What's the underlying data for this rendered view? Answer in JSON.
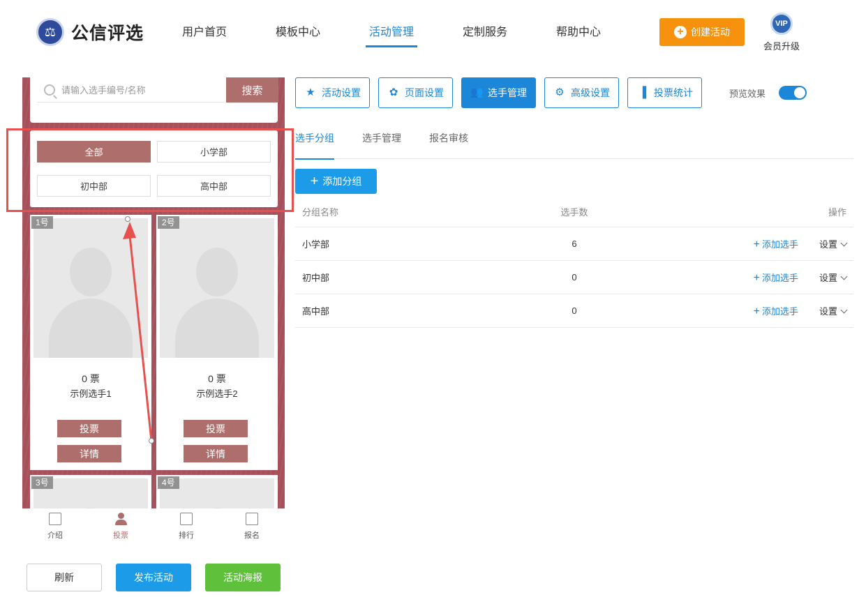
{
  "header": {
    "logo_text": "公信评选",
    "nav": [
      "用户首页",
      "模板中心",
      "活动管理",
      "定制服务",
      "帮助中心"
    ],
    "active_nav": "活动管理",
    "create_btn": "创建活动",
    "vip_badge": "VIP",
    "vip_label": "会员升级"
  },
  "phone": {
    "search_placeholder": "请输入选手编号/名称",
    "search_btn": "搜索",
    "groups": [
      "全部",
      "小学部",
      "初中部",
      "高中部"
    ],
    "active_group": "全部",
    "contestants": [
      {
        "num": "1号",
        "votes": "0 票",
        "name": "示例选手1",
        "vote_btn": "投票",
        "detail_btn": "详情"
      },
      {
        "num": "2号",
        "votes": "0 票",
        "name": "示例选手2",
        "vote_btn": "投票",
        "detail_btn": "详情"
      },
      {
        "num": "3号"
      },
      {
        "num": "4号"
      }
    ],
    "tabbar": [
      "介绍",
      "投票",
      "排行",
      "报名"
    ],
    "active_tab": "投票"
  },
  "bottom_buttons": {
    "refresh": "刷新",
    "publish": "发布活动",
    "poster": "活动海报"
  },
  "toolbar": {
    "buttons": [
      {
        "label": "活动设置",
        "icon": "star-icon"
      },
      {
        "label": "页面设置",
        "icon": "flower-icon"
      },
      {
        "label": "选手管理",
        "icon": "users-icon"
      },
      {
        "label": "高级设置",
        "icon": "gear-list-icon"
      },
      {
        "label": "投票统计",
        "icon": "bar-chart-icon"
      }
    ],
    "active": "选手管理",
    "preview_label": "预览效果",
    "preview_on": true
  },
  "subtabs": [
    "选手分组",
    "选手管理",
    "报名审核"
  ],
  "active_subtab": "选手分组",
  "add_group_btn": "添加分组",
  "table": {
    "headers": [
      "分组名称",
      "选手数",
      "操作"
    ],
    "rows": [
      {
        "name": "小学部",
        "count": "6",
        "add": "添加选手",
        "setting": "设置"
      },
      {
        "name": "初中部",
        "count": "0",
        "add": "添加选手",
        "setting": "设置"
      },
      {
        "name": "高中部",
        "count": "0",
        "add": "添加选手",
        "setting": "设置"
      }
    ]
  },
  "colors": {
    "accent": "#1c86d8",
    "theme": "#ad6e6c",
    "orange": "#f7920f",
    "green": "#5ec03b",
    "annotation": "#e85050"
  }
}
